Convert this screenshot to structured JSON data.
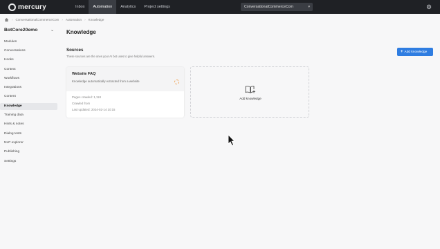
{
  "app": {
    "logo_text": "mercury"
  },
  "nav": {
    "items": [
      "Inbox",
      "Automation",
      "Analytics",
      "Project settings"
    ],
    "active_index": 1
  },
  "project_select": {
    "value": "ConversationalCommerceCom"
  },
  "breadcrumb": [
    "ConversationalCommerceCom",
    "Automation",
    "Knowledge"
  ],
  "sidebar": {
    "bot_name": "BotCore20emo",
    "items": [
      "Modules",
      "Conversations",
      "Hooks",
      "Context",
      "Workflows",
      "Integrations",
      "Content",
      "Knowledge",
      "Training data",
      "Hints & notes",
      "Dialog tests",
      "NLP explorer",
      "Publishing",
      "Settings"
    ],
    "active_index": 7
  },
  "main": {
    "title": "Knowledge",
    "sources_title": "Sources",
    "sources_desc": "These sources are the ones your AI bot uses to give helpful answers.",
    "add_button": "Add knowledge",
    "card": {
      "title": "Website FAQ",
      "desc": "Knowledge automatically extracted from a website",
      "meta1": "Pages crawled: 1,118",
      "meta2": "Crawled from",
      "meta3": "Last updated: 2024-02-14 10:15"
    },
    "add_card_label": "Add knowledge"
  },
  "colors": {
    "accent": "#2f7de1",
    "topbar": "#1f2125",
    "active_nav": "#3a3d43",
    "spinner": "#f0a050"
  },
  "icons": [
    "logo-icon",
    "home-icon",
    "chevron-down-icon",
    "gear-icon",
    "plus-icon",
    "spinner-icon",
    "book-plus-icon",
    "mouse-cursor-icon"
  ]
}
